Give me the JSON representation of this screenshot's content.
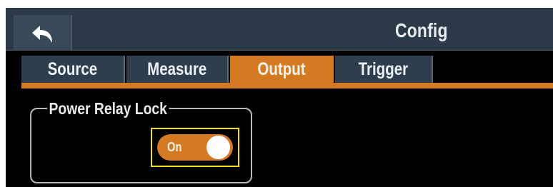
{
  "header": {
    "title": "Config",
    "back_icon": "back-arrow-icon"
  },
  "tabs": [
    {
      "label": "Source",
      "active": false
    },
    {
      "label": "Measure",
      "active": false
    },
    {
      "label": "Output",
      "active": true
    },
    {
      "label": "Trigger",
      "active": false
    }
  ],
  "power_relay_lock": {
    "group_title": "Power Relay Lock",
    "toggle_state": "On",
    "toggle_color": "#d47a23",
    "focus_color": "#f0e11c"
  }
}
